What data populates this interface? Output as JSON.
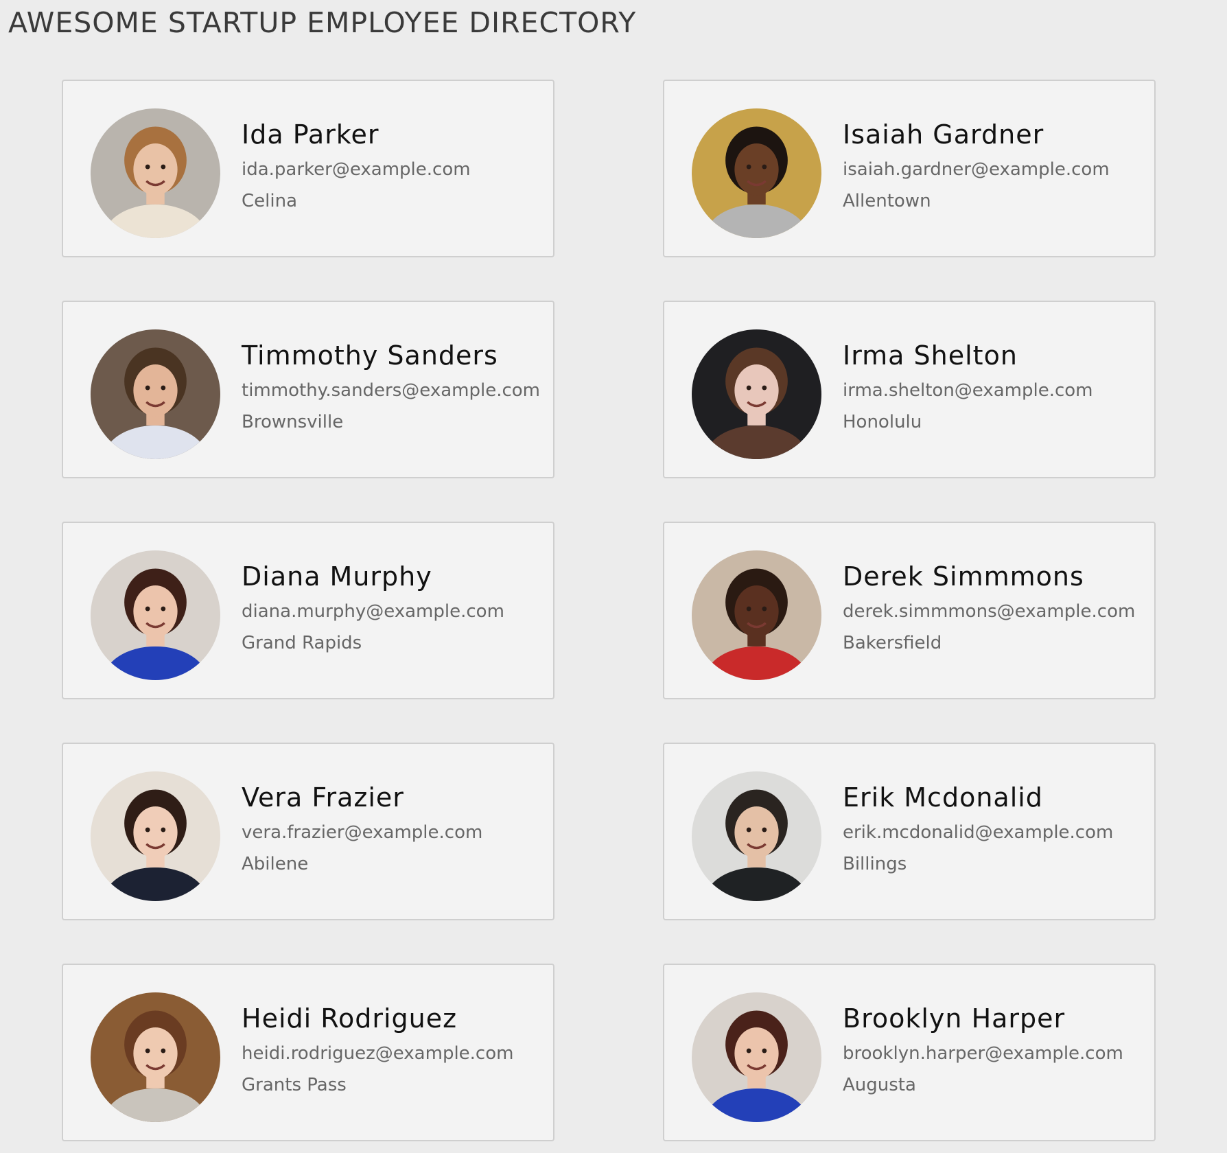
{
  "header": {
    "title": "AWESOME STARTUP EMPLOYEE DIRECTORY"
  },
  "employees": [
    {
      "name": "Ida Parker",
      "email": "ida.parker@example.com",
      "city": "Celina",
      "photo": {
        "bg": "#b9b4ad",
        "skin": "#e9c2a6",
        "hair": "#a8713f",
        "shirt": "#ece3d4"
      }
    },
    {
      "name": "Isaiah Gardner",
      "email": "isaiah.gardner@example.com",
      "city": "Allentown",
      "photo": {
        "bg": "#c7a24a",
        "skin": "#6a3f26",
        "hair": "#1c1410",
        "shirt": "#b4b4b4"
      }
    },
    {
      "name": "Timmothy Sanders",
      "email": "timmothy.sanders@example.com",
      "city": "Brownsville",
      "photo": {
        "bg": "#6d5a4c",
        "skin": "#e3b598",
        "hair": "#4a3422",
        "shirt": "#dfe3ee"
      }
    },
    {
      "name": "Irma Shelton",
      "email": "irma.shelton@example.com",
      "city": "Honolulu",
      "photo": {
        "bg": "#1f1f22",
        "skin": "#e8c7bb",
        "hair": "#5a3826",
        "shirt": "#5b3b2e"
      }
    },
    {
      "name": "Diana Murphy",
      "email": "diana.murphy@example.com",
      "city": "Grand Rapids",
      "photo": {
        "bg": "#d8d2cc",
        "skin": "#ecc4ac",
        "hair": "#3e2018",
        "shirt": "#2340b8"
      }
    },
    {
      "name": "Derek Simmmons",
      "email": "derek.simmmons@example.com",
      "city": "Bakersfield",
      "photo": {
        "bg": "#c9b8a6",
        "skin": "#5a3020",
        "hair": "#2a1a12",
        "shirt": "#c92a2a"
      }
    },
    {
      "name": "Vera Frazier",
      "email": "vera.frazier@example.com",
      "city": "Abilene",
      "photo": {
        "bg": "#e6dfd6",
        "skin": "#f0cdb8",
        "hair": "#2f1d16",
        "shirt": "#1c2233"
      }
    },
    {
      "name": "Erik Mcdonalid",
      "email": "erik.mcdonalid@example.com",
      "city": "Billings",
      "photo": {
        "bg": "#dcdcda",
        "skin": "#e4c0a6",
        "hair": "#2a2420",
        "shirt": "#1f2224"
      }
    },
    {
      "name": "Heidi Rodriguez",
      "email": "heidi.rodriguez@example.com",
      "city": "Grants Pass",
      "photo": {
        "bg": "#8a5c34",
        "skin": "#efcab1",
        "hair": "#6a3c22",
        "shirt": "#c9c4bc"
      }
    },
    {
      "name": "Brooklyn Harper",
      "email": "brooklyn.harper@example.com",
      "city": "Augusta",
      "photo": {
        "bg": "#d8d2cc",
        "skin": "#ecc4ac",
        "hair": "#4a221a",
        "shirt": "#2340b8"
      }
    }
  ]
}
